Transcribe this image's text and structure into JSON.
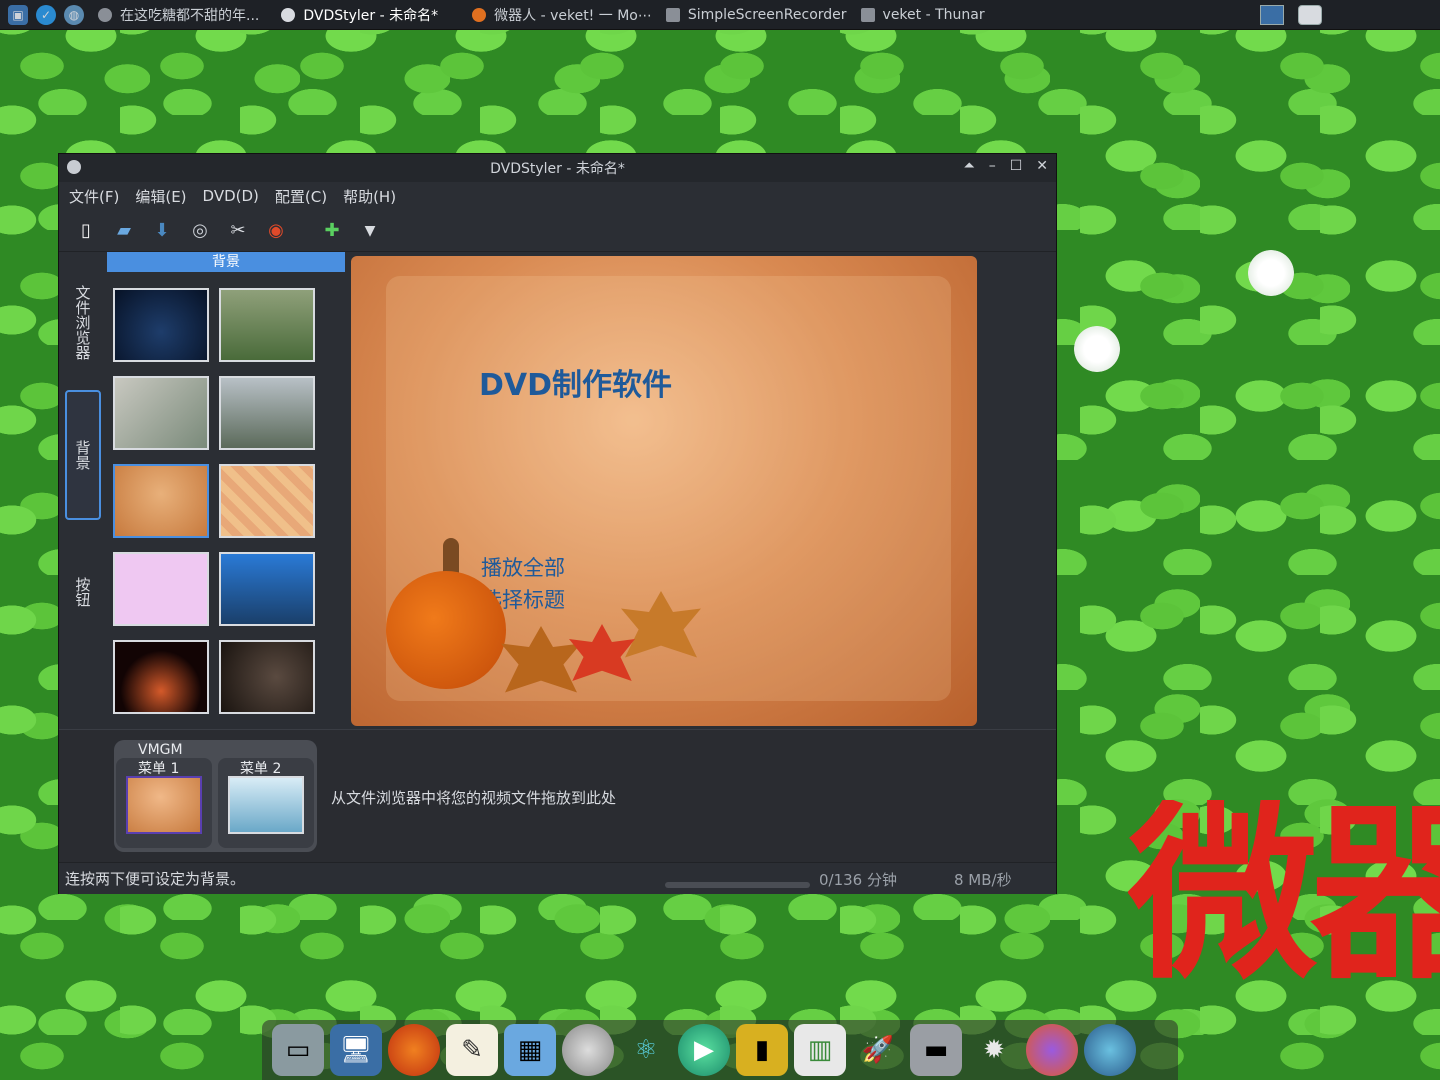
{
  "taskbar": {
    "tasks": [
      {
        "label": "在这吃糖都不甜的年..."
      },
      {
        "label": "DVDStyler - 未命名*"
      },
      {
        "label": "微器人 - veket! 一 Mo⋯"
      },
      {
        "label": "SimpleScreenRecorder"
      },
      {
        "label": "veket - Thunar"
      }
    ]
  },
  "window": {
    "title": "DVDStyler - 未命名*",
    "controls": {
      "shade": "⏶",
      "minimize": "–",
      "maximize": "☐",
      "close": "✕"
    }
  },
  "menu": {
    "items": [
      "文件(F)",
      "编辑(E)",
      "DVD(D)",
      "配置(C)",
      "帮助(H)"
    ]
  },
  "toolbar": {
    "icons": [
      "new-icon",
      "open-icon",
      "save-icon",
      "burn-icon",
      "settings-icon",
      "dvd-icon",
      "add-file-icon",
      "dropdown-arrow-icon"
    ]
  },
  "side_tabs": {
    "file_browser": "文件浏览器",
    "background": "背景",
    "buttons": "按钮"
  },
  "bg_panel": {
    "header": "背景"
  },
  "preview": {
    "title": "DVD制作软件",
    "btn_play_all": "播放全部",
    "btn_select_title": "选择标题"
  },
  "titleset": {
    "vmgm_label": "VMGM",
    "menu1_label": "菜单 1",
    "menu2_label": "菜单 2",
    "drop_hint": "从文件浏览器中将您的视频文件拖放到此处"
  },
  "status": {
    "left": "连按两下便可设定为背景。",
    "minutes": "0/136 分钟",
    "rate": "8 MB/秒"
  },
  "desktop": {
    "big_text": "微器"
  },
  "colors": {
    "accent": "#4a8fe0",
    "preview_text": "#1f5a9a",
    "big_text": "#e0241c"
  }
}
